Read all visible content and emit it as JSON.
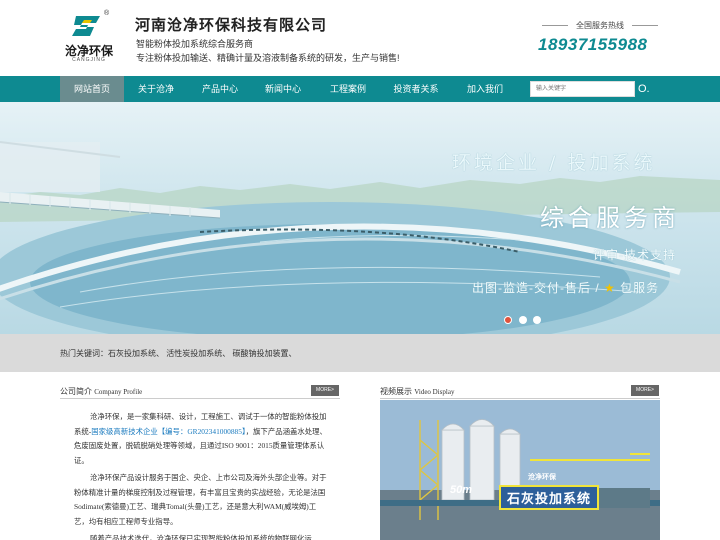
{
  "header": {
    "logo_text": "沧净环保",
    "logo_sub": "CANGJING",
    "registered": "®",
    "company_name": "河南沧净环保科技有限公司",
    "tagline1": "智能粉体投加系统综合服务商",
    "tagline2": "专注粉体投加输送、精确计量及溶液制备系统的研发，生产与销售!",
    "hotline_label": "全国服务热线",
    "hotline_number": "18937155988"
  },
  "nav": {
    "items": [
      "网站首页",
      "关于沧净",
      "产品中心",
      "新闻中心",
      "工程案例",
      "投资者关系",
      "加入我们"
    ],
    "active_index": 0,
    "search_placeholder": "输入关键字",
    "search_button": "O."
  },
  "banner": {
    "line1": "环境企业 / 投加系统",
    "line2": "综合服务商",
    "line3": "评审-技术支持",
    "line4_a": "出图-监造-交付-售后 / ",
    "line4_star": "★",
    "line4_b": " 包服务",
    "slide_count": 3,
    "active_slide": 0
  },
  "keywords": {
    "text": "热门关键词：石灰投加系统、 活性炭投加系统、 碳酸钠投加装置、"
  },
  "profile": {
    "title_cn": "公司简介",
    "title_en": "Company Profile",
    "more": "MORE>",
    "p1_a": "沧净环保，是一家集科研、设计，工程施工、调试于一体的智能粉体投加系统-",
    "p1_hl": "国家级高新技术企业【编号：GR202341000885】",
    "p1_b": "，旗下产品涵盖水处理、危废固废处置，脱硫脱硝处理等领域，且通过ISO 9001：2015质量管理体系认证。",
    "p2": "沧净环保产品设计服务于国企、央企、上市公司及海外头部企业等。对于粉体精准计量的梯度控制及过程管理，有丰富且宝贵的实战经验，无论是法国Sodimate(索德曼)工艺、瑞典Tomal(头曼)工艺，还是意大利WAM(威埃姆)工艺，均有相应工程师专业指导。",
    "p3": "随着产品技术迭代，沧净环保已实现智能粉体投加系统的物联网化运"
  },
  "video": {
    "title_cn": "视频展示",
    "title_en": "Video Display",
    "more": "MORE>",
    "caption": "石灰投加系统",
    "brand": "沧净环保",
    "number": "50m"
  },
  "colors": {
    "brand_teal": "#0e8a91",
    "nav_active": "#6a8c8f",
    "highlight_link": "#1b7bbf",
    "dot_active": "#e0533d"
  }
}
